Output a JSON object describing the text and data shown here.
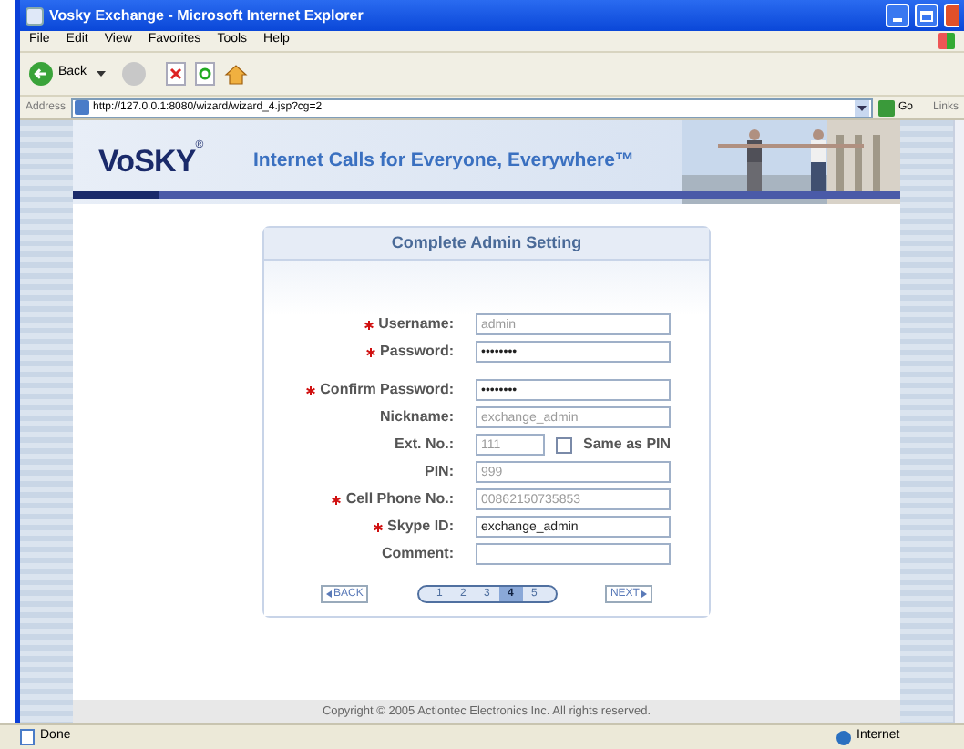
{
  "window": {
    "title": "Vosky Exchange - Microsoft Internet Explorer"
  },
  "menu": [
    "File",
    "Edit",
    "View",
    "Favorites",
    "Tools",
    "Help"
  ],
  "toolbar": {
    "back": "Back"
  },
  "address": {
    "label": "Address",
    "url": "http://127.0.0.1:8080/wizard/wizard_4.jsp?cg=2",
    "go": "Go",
    "links": "Links"
  },
  "banner": {
    "logo": "VoSKY",
    "logo_mark": "®",
    "tagline": "Internet Calls for Everyone, Everywhere™"
  },
  "panel": {
    "title": "Complete Admin Setting",
    "fields": [
      {
        "kind": "text",
        "label": "Username:",
        "required": true,
        "value": "admin",
        "disabled": true
      },
      {
        "kind": "password",
        "label": "Password:",
        "required": true,
        "value": "••••••••",
        "disabled": false
      },
      {
        "kind": "password",
        "label": "Confirm Password:",
        "required": true,
        "value": "••••••••",
        "disabled": false
      },
      {
        "kind": "text",
        "label": "Nickname:",
        "required": false,
        "value": "exchange_admin",
        "disabled": true
      },
      {
        "kind": "ext",
        "label": "Ext. No.:",
        "required": false,
        "value": "111",
        "disabled": true,
        "checkbox": {
          "label": "Same as PIN",
          "checked": false
        }
      },
      {
        "kind": "text",
        "label": "PIN:",
        "required": false,
        "value": "999",
        "disabled": true
      },
      {
        "kind": "text",
        "label": "Cell Phone No.:",
        "required": true,
        "value": "00862150735853",
        "disabled": true
      },
      {
        "kind": "text",
        "label": "Skype ID:",
        "required": true,
        "value": "exchange_admin",
        "disabled": false
      },
      {
        "kind": "text",
        "label": "Comment:",
        "required": false
      }
    ],
    "back": "BACK",
    "next": "NEXT",
    "steps": [
      {
        "label": "1",
        "selected": false
      },
      {
        "label": "2",
        "selected": false
      },
      {
        "label": "3",
        "selected": false
      },
      {
        "label": "4",
        "selected": true
      },
      {
        "label": "5",
        "selected": false
      }
    ]
  },
  "footer": {
    "copyright": "Copyright © 2005 Actiontec Electronics Inc. All rights reserved."
  },
  "status_bar": {
    "text": "Done",
    "zone": "Internet"
  }
}
